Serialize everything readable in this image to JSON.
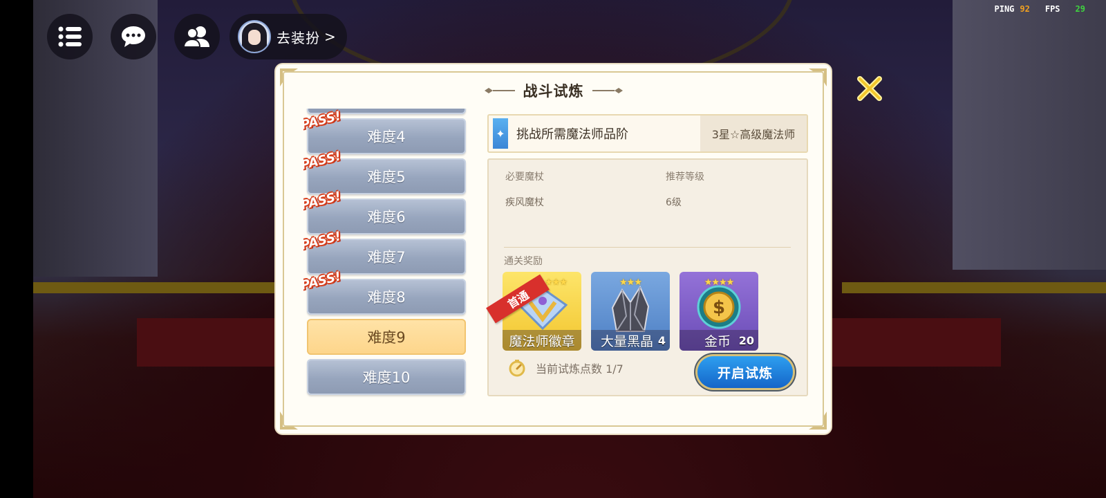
{
  "hud": {
    "profile_label": "去装扮",
    "profile_chevron": ">",
    "ping_label": "PING",
    "ping_value": "92",
    "fps_label": "FPS",
    "fps_value": "29",
    "icons": [
      "menu-icon",
      "chat-bubble-icon",
      "friends-icon",
      "close-icon"
    ]
  },
  "dialog": {
    "title": "战斗试炼",
    "difficulties": [
      {
        "label": "难度4",
        "passed": true,
        "selected": false
      },
      {
        "label": "难度5",
        "passed": true,
        "selected": false
      },
      {
        "label": "难度6",
        "passed": true,
        "selected": false
      },
      {
        "label": "难度7",
        "passed": true,
        "selected": false
      },
      {
        "label": "难度8",
        "passed": true,
        "selected": false
      },
      {
        "label": "难度9",
        "passed": false,
        "selected": true
      },
      {
        "label": "难度10",
        "passed": false,
        "selected": false
      }
    ],
    "pass_badge": "PASS!",
    "requirement": {
      "label": "挑战所需魔法师品阶",
      "value": "3星☆高级魔法师"
    },
    "info": {
      "wand_title": "必要魔杖",
      "wand_value": "疾风魔杖",
      "level_title": "推荐等级",
      "level_value": "6级"
    },
    "rewards_title": "通关奖励",
    "rewards": [
      {
        "name": "魔法师徽章",
        "count": "",
        "stars": "★★★",
        "ribbon": "首通",
        "color": "#f7d846"
      },
      {
        "name": "大量黑晶",
        "count": "4",
        "stars": "★★★",
        "ribbon": "",
        "color": "#5a8fcf"
      },
      {
        "name": "金币",
        "count": "20",
        "stars": "★★★★",
        "ribbon": "",
        "color": "#7a5fc8"
      }
    ],
    "points_label": "当前试炼点数 1/7",
    "start_button": "开启试炼"
  }
}
